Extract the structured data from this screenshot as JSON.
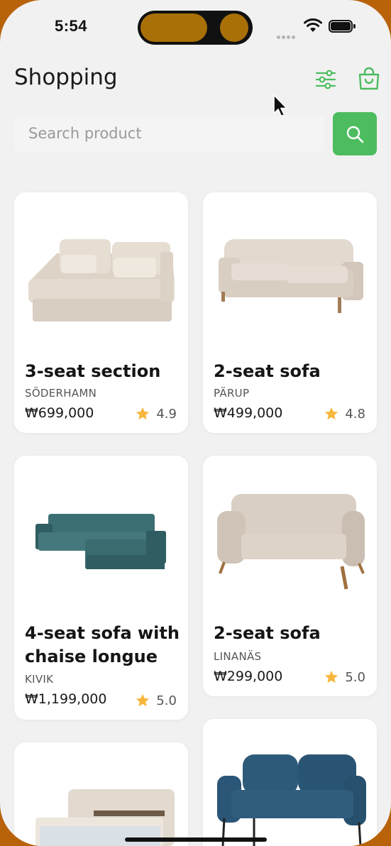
{
  "status": {
    "time": "5:54"
  },
  "header": {
    "title": "Shopping"
  },
  "search": {
    "placeholder": "Search product"
  },
  "colors": {
    "accent": "#4cbc5e",
    "star": "#f6b73c",
    "teal_sofa": "#3c6f73",
    "blue_sofa": "#2e5a7a",
    "beige_sofa": "#e2d9cf"
  },
  "products": [
    {
      "name": "3-seat section",
      "brand": "SÖDERHAMN",
      "price": "₩699,000",
      "rating": "4.9"
    },
    {
      "name": "2-seat sofa",
      "brand": "PÄRUP",
      "price": "₩499,000",
      "rating": "4.8"
    },
    {
      "name": "4-seat sofa with chaise longue",
      "brand": "KIVIK",
      "price": "₩1,199,000",
      "rating": "5.0"
    },
    {
      "name": "2-seat sofa",
      "brand": "LINANÄS",
      "price": "₩299,000",
      "rating": "5.0"
    }
  ]
}
